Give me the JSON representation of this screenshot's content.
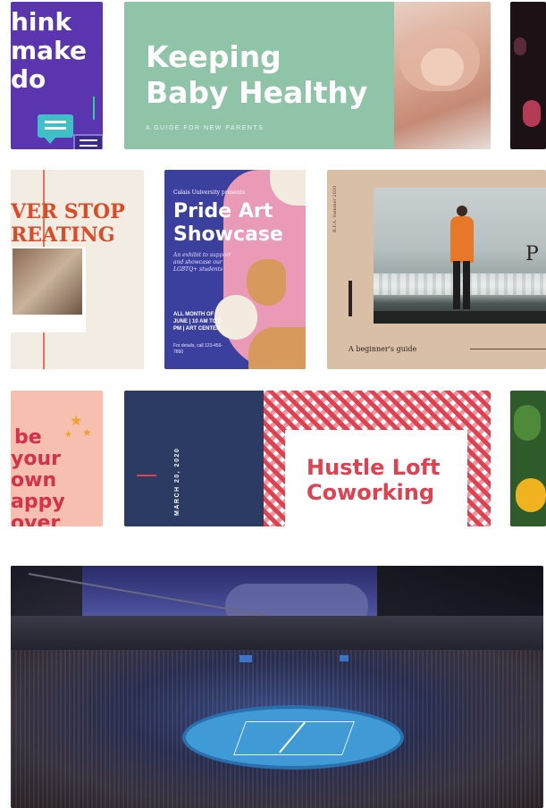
{
  "colors": {
    "purple": "#5b35b0",
    "mint": "#8fc4a8",
    "cream": "#f2ece2",
    "pride_blue": "#3b3f9e",
    "pride_pink": "#ea9ab7",
    "tan": "#d8bfa6",
    "salmon": "#f7bfb0",
    "navy": "#2b3b64",
    "red": "#e2404f",
    "orange_title": "#dd4a27"
  },
  "row1": {
    "think": {
      "lines": [
        "hink",
        "make",
        "do"
      ]
    },
    "baby": {
      "title_line1": "Keeping",
      "title_line2": "Baby Healthy",
      "subtitle": "A GUIDE FOR NEW PARENTS"
    }
  },
  "row2": {
    "creating": {
      "line1": "VER STOP",
      "line2": "REATING"
    },
    "pride": {
      "presenter": "Calais University presents",
      "title_line1": "Pride Art",
      "title_line2": "Showcase",
      "blurb": "An exhibit to support and showcase our LGBTQ+ students",
      "when": "ALL MONTH OF JUNE | 10 AM TO 5 PM | ART CENTER",
      "contact": "For details, call 123-456-7890"
    },
    "beginner": {
      "side_label": "B.F.A. Summer 2020",
      "caption": "A beginner's guide",
      "partial_letter": "P"
    }
  },
  "row3": {
    "happy": {
      "lines": [
        "be",
        "your",
        "own",
        "appy",
        "over"
      ]
    },
    "hustle": {
      "date": "MARCH 20, 2020",
      "title_line1": "Hustle Loft",
      "title_line2": "Coworking"
    }
  },
  "stadium": {
    "screen_icon": "scoreboard-icon"
  }
}
